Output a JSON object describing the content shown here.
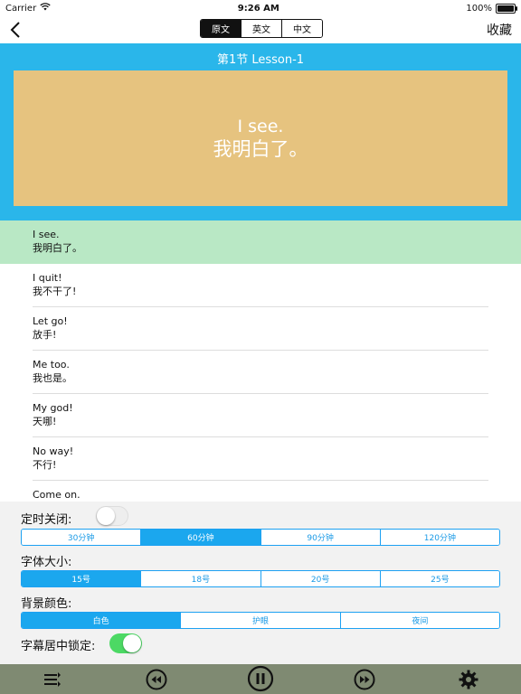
{
  "status_bar": {
    "carrier": "Carrier",
    "time": "9:26 AM",
    "battery": "100%"
  },
  "nav": {
    "tabs": [
      {
        "label": "原文",
        "active": true
      },
      {
        "label": "英文",
        "active": false
      },
      {
        "label": "中文",
        "active": false
      }
    ],
    "favorite_label": "收藏",
    "back_icon": "chevron-left-icon"
  },
  "hero": {
    "title": "第1节  Lesson-1",
    "card_en": "I see.",
    "card_zh": "我明白了。",
    "background_color": "#2ab6ea",
    "card_color": "#e6c37f"
  },
  "sentences": [
    {
      "en": "I see.",
      "zh": "我明白了。",
      "active": true
    },
    {
      "en": "I quit!",
      "zh": "我不干了!",
      "active": false
    },
    {
      "en": "Let go!",
      "zh": "放手!",
      "active": false
    },
    {
      "en": "Me too.",
      "zh": "我也是。",
      "active": false
    },
    {
      "en": "My god!",
      "zh": "天哪!",
      "active": false
    },
    {
      "en": "No way!",
      "zh": "不行!",
      "active": false
    },
    {
      "en": "Come on.",
      "zh": "",
      "active": false
    }
  ],
  "settings": {
    "timer": {
      "label": "定时关闭:",
      "enabled": false,
      "options": [
        "30分钟",
        "60分钟",
        "90分钟",
        "120分钟"
      ],
      "selected": 1
    },
    "font_size": {
      "label": "字体大小:",
      "options": [
        "15号",
        "18号",
        "20号",
        "25号"
      ],
      "selected": 0
    },
    "background": {
      "label": "背景颜色:",
      "options": [
        "白色",
        "护眼",
        "夜间"
      ],
      "selected": 0
    },
    "center_lock": {
      "label": "字幕居中锁定:",
      "enabled": true
    }
  },
  "player": {
    "icons": [
      "playlist-icon",
      "rewind-icon",
      "pause-icon",
      "fast-forward-icon",
      "settings-gear-icon"
    ],
    "bar_color": "#7f8a72"
  }
}
